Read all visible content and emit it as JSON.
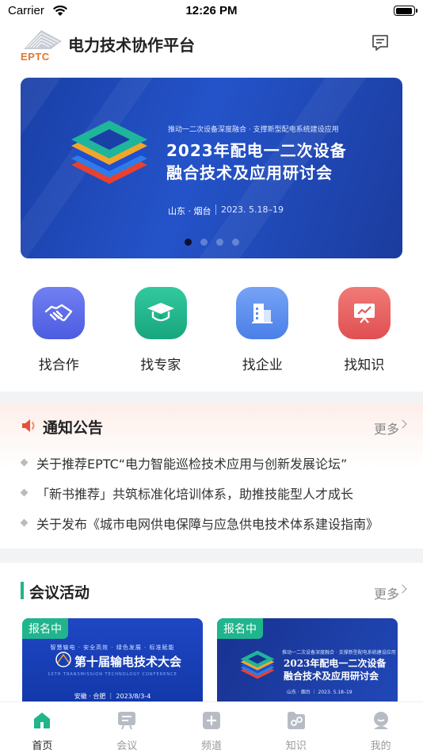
{
  "status": {
    "carrier": "Carrier",
    "time": "12:26 PM"
  },
  "header": {
    "logo_text": "EPTC",
    "title": "电力技术协作平台"
  },
  "banner": {
    "subtitle": "推动一二次设备深度融合 · 支撑新型配电系统建设应用",
    "title_line1": "2023年配电一二次设备",
    "title_line2": "融合技术及应用研讨会",
    "place": "山东 · 烟台",
    "date": "2023. 5.18–19",
    "slide_count": 4,
    "active_slide": 1
  },
  "quick": [
    {
      "label": "找合作",
      "icon": "handshake-icon",
      "color": "#5b6bea"
    },
    {
      "label": "找专家",
      "icon": "graduation-cap-icon",
      "color": "#22b68d"
    },
    {
      "label": "找企业",
      "icon": "building-icon",
      "color": "#5a8ef0"
    },
    {
      "label": "找知识",
      "icon": "presentation-chart-icon",
      "color": "#e8575a"
    }
  ],
  "notice": {
    "title": "通知公告",
    "more": "更多",
    "items": [
      "关于推荐EPTC“电力智能巡检技术应用与创新发展论坛”",
      "「新书推荐」共筑标准化培训体系，助推技能型人才成长",
      "关于发布《城市电网供电保障与应急供电技术体系建设指南》"
    ]
  },
  "meetings": {
    "title": "会议活动",
    "more": "更多",
    "cards": [
      {
        "tag": "报名中",
        "subtitle": "智慧输电 · 安全高效 · 绿色发展 · 标准赋能",
        "title": "第十届输电技术大会",
        "english": "10TH TRANSMISSION TECHNOLOGY CONFERENCE",
        "date": "安徽 · 合肥 ｜ 2023/8/3-4"
      },
      {
        "tag": "报名中",
        "subtitle": "推动一二次设备深度融合 · 支撑新型配电系统建设应用",
        "title_line1": "2023年配电一二次设备",
        "title_line2": "融合技术及应用研讨会",
        "date": "山东 · 烟台 ｜ 2023. 5.18–19"
      }
    ]
  },
  "tabs": [
    {
      "label": "首页",
      "icon": "home-icon",
      "active": true
    },
    {
      "label": "会议",
      "icon": "meeting-icon",
      "active": false
    },
    {
      "label": "频道",
      "icon": "channel-icon",
      "active": false
    },
    {
      "label": "知识",
      "icon": "knowledge-icon",
      "active": false
    },
    {
      "label": "我的",
      "icon": "profile-icon",
      "active": false
    }
  ],
  "colors": {
    "accent": "#20b58c",
    "notice_red": "#e8503a"
  }
}
